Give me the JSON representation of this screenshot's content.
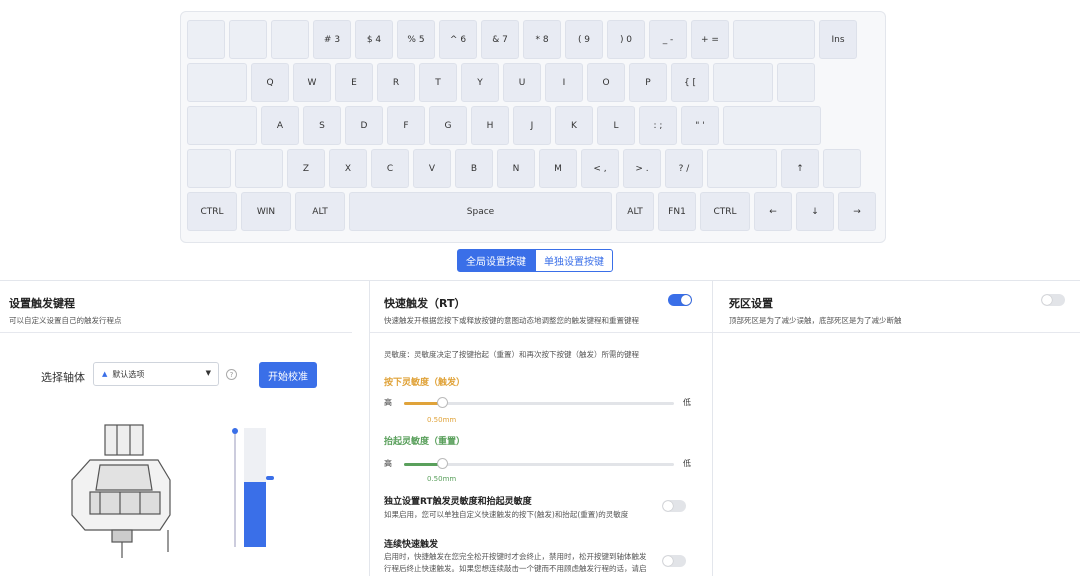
{
  "keyboard": {
    "row1": [
      "",
      "",
      "",
      "# 3",
      "$ 4",
      "% 5",
      "^ 6",
      "& 7",
      "* 8",
      "( 9",
      ") 0",
      "_ -",
      "+ =",
      "",
      "Ins"
    ],
    "row2": [
      "",
      "Q",
      "W",
      "E",
      "R",
      "T",
      "Y",
      "U",
      "I",
      "O",
      "P",
      "{ [",
      "",
      ""
    ],
    "row3": [
      "",
      "A",
      "S",
      "D",
      "F",
      "G",
      "H",
      "J",
      "K",
      "L",
      ": ;",
      "\" '",
      ""
    ],
    "row4": [
      "",
      "",
      "Z",
      "X",
      "C",
      "V",
      "B",
      "N",
      "M",
      "< ,",
      "> .",
      "? /",
      "",
      "↑",
      ""
    ],
    "row5": [
      "CTRL",
      "WIN",
      "ALT",
      "Space",
      "ALT",
      "FN1",
      "CTRL",
      "←",
      "↓",
      "→"
    ]
  },
  "tabs": {
    "global": "全局设置按键",
    "single": "单独设置按键"
  },
  "trigger": {
    "title": "设置触发键程",
    "desc": "可以自定义设置自己的触发行程点",
    "axis_label": "选择轴体",
    "select_value": "默认选项",
    "help": "?",
    "calibrate": "开始校准",
    "travel_level": 0.55
  },
  "rt": {
    "title": "快速触发（RT）",
    "desc": "快速触发开根据您按下或释放按键的意图动态地调整您的触发键程和重置键程",
    "enabled": true,
    "sensitivity_desc": "灵敏度：灵敏度决定了按键抬起（重置）和再次按下按键（触发）所需的键程",
    "press_title": "按下灵敏度（触发）",
    "press_high": "高",
    "press_low": "低",
    "press_value": "0.50mm",
    "press_level": 0.14,
    "release_title": "抬起灵敏度（重置）",
    "release_high": "高",
    "release_low": "低",
    "release_value": "0.50mm",
    "release_level": 0.14,
    "independent_title": "独立设置RT触发灵敏度和抬起灵敏度",
    "independent_desc": "如果启用，您可以单独自定义快速触发的按下(触发)和抬起(重置)的灵敏度",
    "continuous_title": "连续快速触发",
    "continuous_desc1": "启用时，快捷触发在您完全松开按键时才会终止，禁用时，松开按键到轴体触发",
    "continuous_desc2": "行程后终止快速触发。如果您想连续敲击一个键而不用顾虑触发行程的话，请启"
  },
  "deadzone": {
    "title": "死区设置",
    "desc": "顶部死区是为了减少误触，底部死区是为了减少断触",
    "enabled": false
  },
  "colors": {
    "accent": "#3a6fe8",
    "press": "#e0a33a",
    "release": "#5aa05c"
  }
}
